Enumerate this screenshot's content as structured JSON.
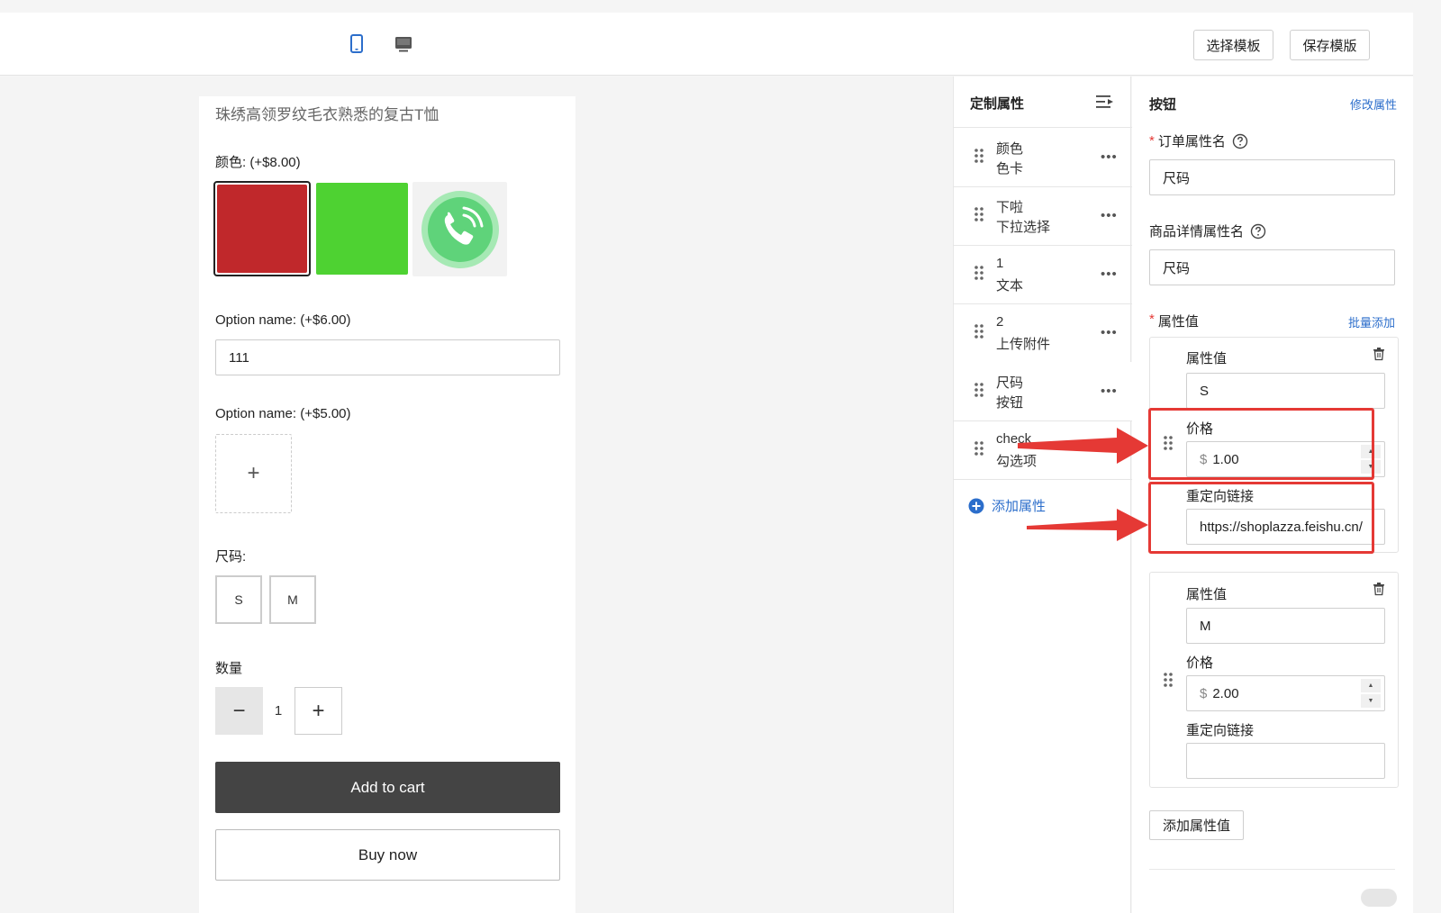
{
  "toolbar": {
    "device_icons": [
      "mobile-icon",
      "desktop-icon"
    ],
    "select_template": "选择模板",
    "save_template": "保存模版",
    "accent_color": "#2c6ecb"
  },
  "preview": {
    "title": "珠绣高领罗纹毛衣熟悉的复古T恤",
    "color_label": "颜色:  (+$8.00)",
    "swatches": [
      "#c0282b",
      "#4ed232",
      "phone-icon"
    ],
    "option1_label": "Option name:  (+$6.00)",
    "option1_value": "111",
    "option2_label": "Option name:  (+$5.00)",
    "upload_symbol": "+",
    "size_label": "尺码:",
    "sizes": [
      "S",
      "M"
    ],
    "qty_label": "数量",
    "qty_minus": "−",
    "qty_value": "1",
    "qty_plus": "+",
    "add_to_cart": "Add to cart",
    "buy_now": "Buy now"
  },
  "attributes": {
    "header": "定制属性",
    "items": [
      {
        "name": "颜色",
        "type": "色卡"
      },
      {
        "name": "下啦",
        "type": "下拉选择"
      },
      {
        "name": "1",
        "type": "文本"
      },
      {
        "name": "2",
        "type": "上传附件"
      },
      {
        "name": "尺码",
        "type": "按钮"
      },
      {
        "name": "check",
        "type": "勾选项"
      }
    ],
    "more": "•••",
    "add_label": "添加属性"
  },
  "properties": {
    "title": "按钮",
    "edit_link": "修改属性",
    "order_attr_label": "订单属性名",
    "order_attr_value": "尺码",
    "detail_attr_label": "商品详情属性名",
    "detail_attr_value": "尺码",
    "values_label": "属性值",
    "batch_add": "批量添加",
    "required_mark": "*",
    "value_field_label": "属性值",
    "price_label": "价格",
    "redirect_label": "重定向链接",
    "currency": "$",
    "values": [
      {
        "value": "S",
        "price": "1.00",
        "redirect": "https://shoplazza.feishu.cn/"
      },
      {
        "value": "M",
        "price": "2.00",
        "redirect": ""
      }
    ],
    "add_value_button": "添加属性值",
    "annotation_color": "#e53935"
  }
}
